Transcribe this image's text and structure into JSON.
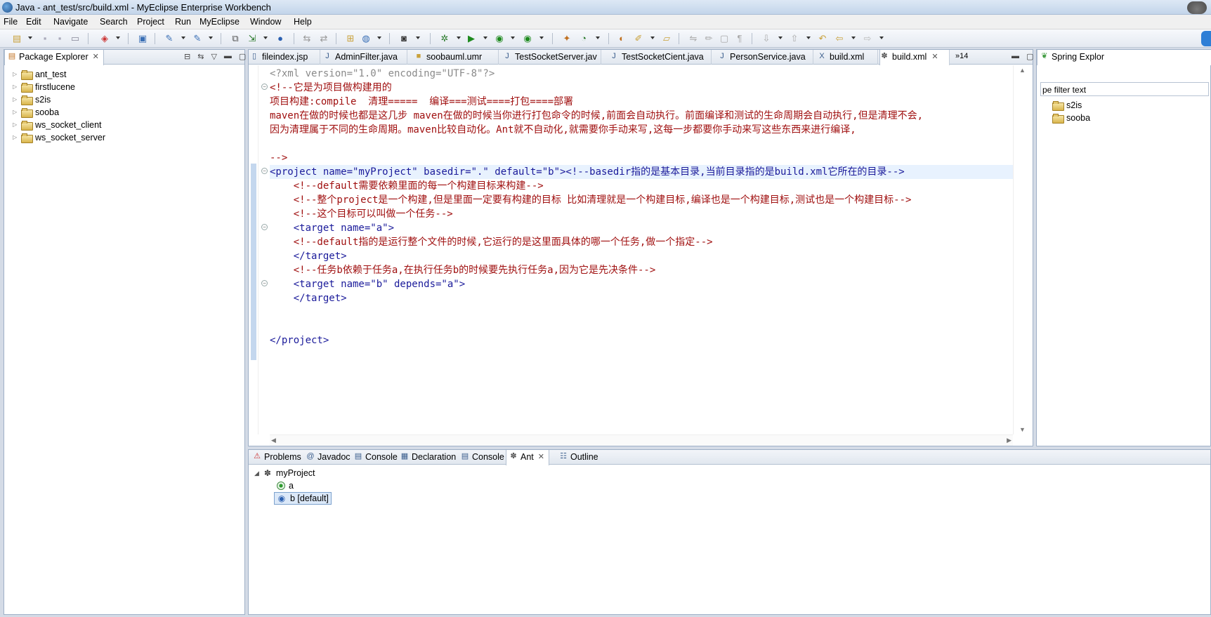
{
  "window": {
    "title": "Java - ant_test/src/build.xml - MyEclipse Enterprise Workbench"
  },
  "menu": [
    "File",
    "Edit",
    "Navigate",
    "Search",
    "Project",
    "Run",
    "MyEclipse",
    "Window",
    "Help"
  ],
  "package_explorer": {
    "title": "Package Explorer",
    "projects": [
      "ant_test",
      "firstlucene",
      "s2is",
      "sooba",
      "ws_socket_client",
      "ws_socket_server"
    ]
  },
  "editor": {
    "tabs": [
      "fileindex.jsp",
      "AdminFilter.java",
      "soobauml.umr",
      "TestSocketServer.jav",
      "TestSocketCient.java",
      "PersonService.java",
      "build.xml",
      "build.xml"
    ],
    "overflow_count": "»14",
    "lines": [
      {
        "t": "<?xml version=\"1.0\" encoding=\"UTF-8\"?>"
      },
      {
        "t": "<!--它是为项目做构建用的"
      },
      {
        "t": "项目构建:compile  清理=====  编译===测试====打包====部署"
      },
      {
        "t": "maven在做的时候也都是这几步 maven在做的时候当你进行打包命令的时候,前面会自动执行。前面编译和测试的生命周期会自动执行,但是清理不会,"
      },
      {
        "t": "因为清理属于不同的生命周期。maven比较自动化。Ant就不自动化,就需要你手动来写,这每一步都要你手动来写这些东西来进行编译,"
      },
      {
        "t": ""
      },
      {
        "t": "-->"
      },
      {
        "t": "<project name=\"myProject\" basedir=\".\" default=\"b\"><!--basedir指的是基本目录,当前目录指的是build.xml它所在的目录-->"
      },
      {
        "t": "    <!--default需要依赖里面的每一个构建目标来构建-->"
      },
      {
        "t": "    <!--整个project是一个构建,但是里面一定要有构建的目标 比如清理就是一个构建目标,编译也是一个构建目标,测试也是一个构建目标-->"
      },
      {
        "t": "    <!--这个目标可以叫做一个任务-->"
      },
      {
        "t": "    <target name=\"a\">"
      },
      {
        "t": "    <!--default指的是运行整个文件的时候,它运行的是这里面具体的哪一个任务,做一个指定-->"
      },
      {
        "t": "    </target>"
      },
      {
        "t": "    <!--任务b依赖于任务a,在执行任务b的时候要先执行任务a,因为它是先决条件-->"
      },
      {
        "t": "    <target name=\"b\" depends=\"a\">"
      },
      {
        "t": "    </target>"
      },
      {
        "t": ""
      },
      {
        "t": ""
      },
      {
        "t": "</project>"
      }
    ]
  },
  "spring": {
    "title": "Spring Explor",
    "filter_text": "pe filter text",
    "items": [
      "s2is",
      "sooba"
    ]
  },
  "bottom": {
    "tabs": [
      "Problems",
      "Javadoc",
      "Console",
      "Declaration",
      "Console",
      "Ant",
      "Outline"
    ],
    "ant_tree": {
      "project": "myProject",
      "targets": [
        "a",
        "b [default]"
      ]
    }
  },
  "colors": {
    "comment": "#a01010",
    "tag": "#1a1a9a",
    "value": "#2a7a00",
    "selection": "#dbe8f8"
  }
}
